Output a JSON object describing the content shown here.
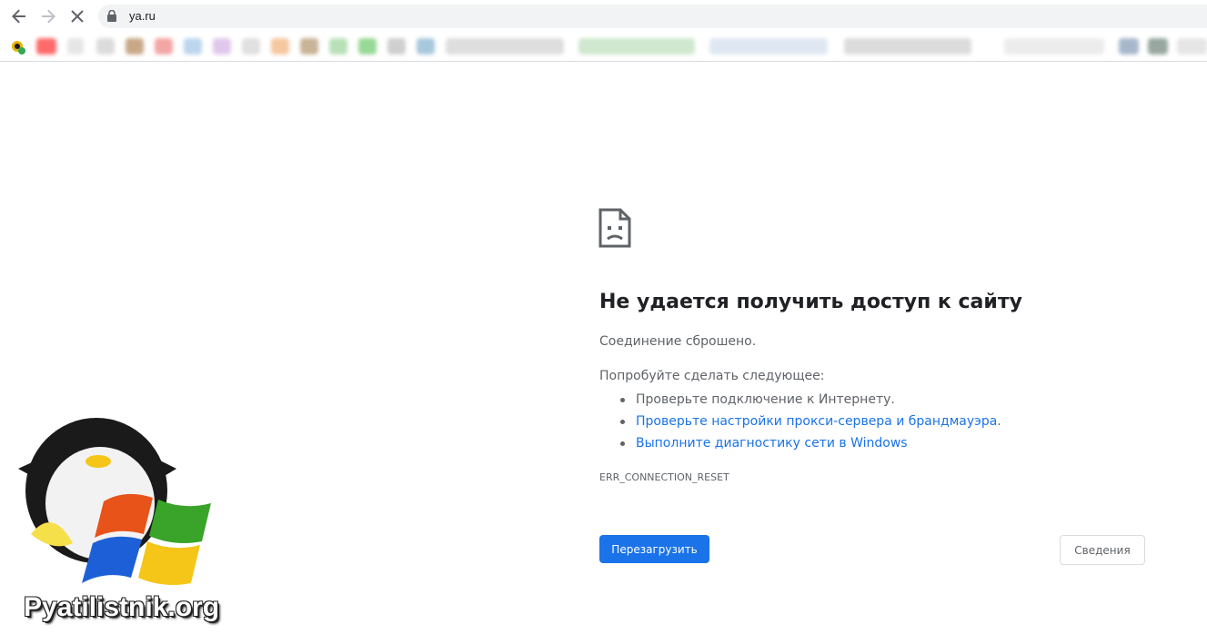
{
  "browser": {
    "url": "ya.ru",
    "nav": {
      "back": "arrow-left-icon",
      "forward": "arrow-right-icon",
      "stop": "close-icon"
    }
  },
  "error": {
    "title": "Не удается получить доступ к сайту",
    "subtitle": "Соединение сброшено.",
    "try_heading": "Попробуйте сделать следующее:",
    "suggestions": {
      "check_connection": "Проверьте подключение к Интернету.",
      "check_proxy": "Проверьте настройки прокси-сервера и брандмауэра",
      "check_proxy_period": ".",
      "run_diagnostics": "Выполните диагностику сети в Windows"
    },
    "code": "ERR_CONNECTION_RESET",
    "reload_label": "Перезагрузить",
    "details_label": "Сведения"
  },
  "watermark": {
    "text": "Pyatilistnik.org"
  },
  "colors": {
    "accent": "#1a73e8",
    "text_primary": "#202124",
    "text_secondary": "#5f6368"
  }
}
